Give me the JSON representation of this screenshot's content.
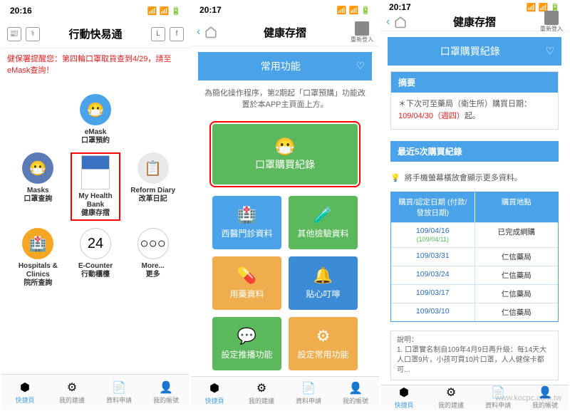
{
  "screens": {
    "s1": {
      "time": "20:16",
      "title": "行動快易通",
      "notice": "健保署提醒您：第四輪口罩取貨查到4/29，請至eMask查詢！",
      "grid": [
        {
          "en": "eMask",
          "zh": "口罩預約"
        },
        {
          "en": "Masks",
          "zh": "口罩查詢"
        },
        {
          "en": "My Health Bank",
          "zh": "健康存摺"
        },
        {
          "en": "Reform Diary",
          "zh": "改革日記"
        },
        {
          "en": "Hospitals & Clinics",
          "zh": "院所查詢"
        },
        {
          "en": "E-Counter",
          "zh": "行動櫃檯"
        },
        {
          "en": "More...",
          "zh": "更多"
        }
      ]
    },
    "s2": {
      "time": "20:17",
      "title": "健康存摺",
      "relogin": "重新登入",
      "header": "常用功能",
      "info": "為簡化操作程序，第2期起「口罩預購」功能改置於本APP主頁面上方。",
      "main_tile": "口罩購買紀錄",
      "tiles": [
        {
          "label": "西醫門診資料",
          "color": "#4aa3e8"
        },
        {
          "label": "其他檢驗資料",
          "color": "#5cb85c"
        },
        {
          "label": "用藥資料",
          "color": "#f0ad4e"
        },
        {
          "label": "貼心叮嚀",
          "color": "#3b8bd6"
        },
        {
          "label": "設定推播功能",
          "color": "#5cb85c"
        },
        {
          "label": "設定常用功能",
          "color": "#f0ad4e"
        }
      ]
    },
    "s3": {
      "time": "20:17",
      "title": "健康存摺",
      "relogin": "重新登入",
      "header": "口罩購買紀錄",
      "summary_title": "摘要",
      "summary_body_prefix": "＊下次可至藥局（衛生所）購買日期：",
      "summary_body_date": "109/04/30（週四）",
      "summary_body_suffix": "起。",
      "records_title": "最近5次購買紀錄",
      "tip": "將手機螢幕橫放會顯示更多資料。",
      "table_head": [
        "購買/認定日期\n(付款/發放日期)",
        "購買地點"
      ],
      "rows": [
        {
          "date": "109/04/16",
          "sub": "(109/04/11)",
          "place": "已完成網購"
        },
        {
          "date": "109/03/31",
          "sub": "",
          "place": "仁信藥局"
        },
        {
          "date": "109/03/24",
          "sub": "",
          "place": "仁信藥局"
        },
        {
          "date": "109/03/17",
          "sub": "",
          "place": "仁信藥局"
        },
        {
          "date": "109/03/10",
          "sub": "",
          "place": "仁信藥局"
        }
      ],
      "desc_title": "說明：",
      "desc_body": "1. 口罩實名制自109年4月9日再升級：每14天大人口罩9片，小孩可買10片口罩，人人健保卡都可..."
    },
    "tabs": [
      "快捷頁",
      "我的建議",
      "資料申請",
      "我的帳號"
    ]
  },
  "watermark": "www.kocpc.com.tw"
}
